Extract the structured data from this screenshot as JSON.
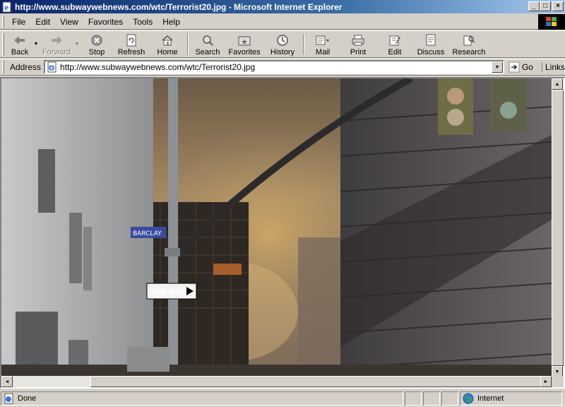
{
  "window": {
    "title": "http://www.subwaywebnews.com/wtc/Terrorist20.jpg - Microsoft Internet Explorer",
    "minimize": "_",
    "maximize": "□",
    "close": "×"
  },
  "menu": {
    "items": [
      "File",
      "Edit",
      "View",
      "Favorites",
      "Tools",
      "Help"
    ]
  },
  "toolbar": {
    "back": "Back",
    "forward": "Forward",
    "stop": "Stop",
    "refresh": "Refresh",
    "home": "Home",
    "search": "Search",
    "favorites": "Favorites",
    "history": "History",
    "mail": "Mail",
    "print": "Print",
    "edit": "Edit",
    "discuss": "Discuss",
    "research": "Research"
  },
  "address": {
    "label": "Address",
    "url": "http://www.subwaywebnews.com/wtc/Terrorist20.jpg",
    "go": "Go",
    "links": "Links"
  },
  "status": {
    "text": "Done",
    "zone": "Internet"
  },
  "colors": {
    "titlebar_start": "#0a246a",
    "titlebar_end": "#a6caf0",
    "chrome": "#d4d0c8"
  }
}
